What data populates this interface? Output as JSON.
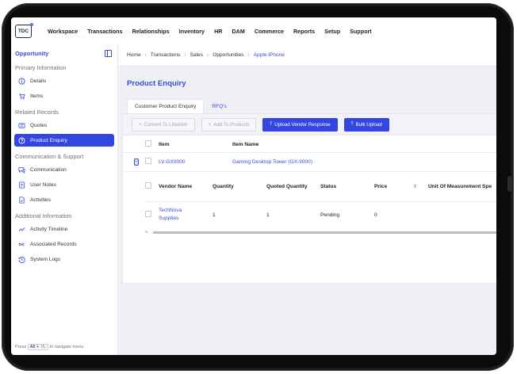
{
  "app": {
    "logo_text": "TDC"
  },
  "topnav": {
    "items": [
      "Workspace",
      "Transactions",
      "Relationships",
      "Inventory",
      "HR",
      "DAM",
      "Commerce",
      "Reports",
      "Setup",
      "Support"
    ]
  },
  "sidebar": {
    "title": "Opportunity",
    "sections": [
      {
        "label": "Primary Information",
        "items": [
          {
            "label": "Details",
            "icon": "info-icon"
          },
          {
            "label": "Items",
            "icon": "cart-icon"
          }
        ]
      },
      {
        "label": "Related Records",
        "items": [
          {
            "label": "Quotes",
            "icon": "quote-icon"
          },
          {
            "label": "Product Enquiry",
            "icon": "help-circle-icon",
            "active": true
          }
        ]
      },
      {
        "label": "Communication & Support",
        "items": [
          {
            "label": "Communication",
            "icon": "chat-icon"
          },
          {
            "label": "User Notes",
            "icon": "note-icon"
          },
          {
            "label": "Activities",
            "icon": "activity-icon"
          }
        ]
      },
      {
        "label": "Additional Information",
        "items": [
          {
            "label": "Activity Timeline",
            "icon": "timeline-icon"
          },
          {
            "label": "Associated Records",
            "icon": "link-icon"
          },
          {
            "label": "System Logs",
            "icon": "history-icon"
          }
        ]
      }
    ],
    "footer": {
      "pre": "Press",
      "keys": "Alt + ↑/↓",
      "post": "to navigate menu"
    }
  },
  "breadcrumb": [
    "Home",
    "Transactions",
    "Sales",
    "Opportunities",
    "Apple iPhone"
  ],
  "page": {
    "title": "Product Enquiry"
  },
  "tabs": [
    "Customer Product Enquiry",
    "RFQ's"
  ],
  "toolbar": {
    "convert_label": "Convert To Lineitem",
    "add_label": "Add To Products",
    "upload_label": "Upload Vendor Response",
    "bulk_label": "Bulk Upload"
  },
  "table": {
    "headers": {
      "item": "Item",
      "item_name": "Item Name"
    },
    "rows": [
      {
        "item": "LV-GX9000",
        "item_name": "Gaming Desktop Tower (GX-9000)",
        "expander": "−"
      }
    ]
  },
  "subtable": {
    "headers": {
      "vendor": "Vendor Name",
      "quantity": "Quantity",
      "quoted": "Quoted Quantity",
      "status": "Status",
      "price": "Price",
      "uom": "Unit Of Measurement",
      "spec": "Spe"
    },
    "rows": [
      {
        "vendor": "TechNova Supplies",
        "quantity": "1",
        "quoted": "1",
        "status": "Pending",
        "price": "0"
      }
    ]
  },
  "colors": {
    "accent": "#3446e0",
    "link": "#3a4bd9"
  }
}
